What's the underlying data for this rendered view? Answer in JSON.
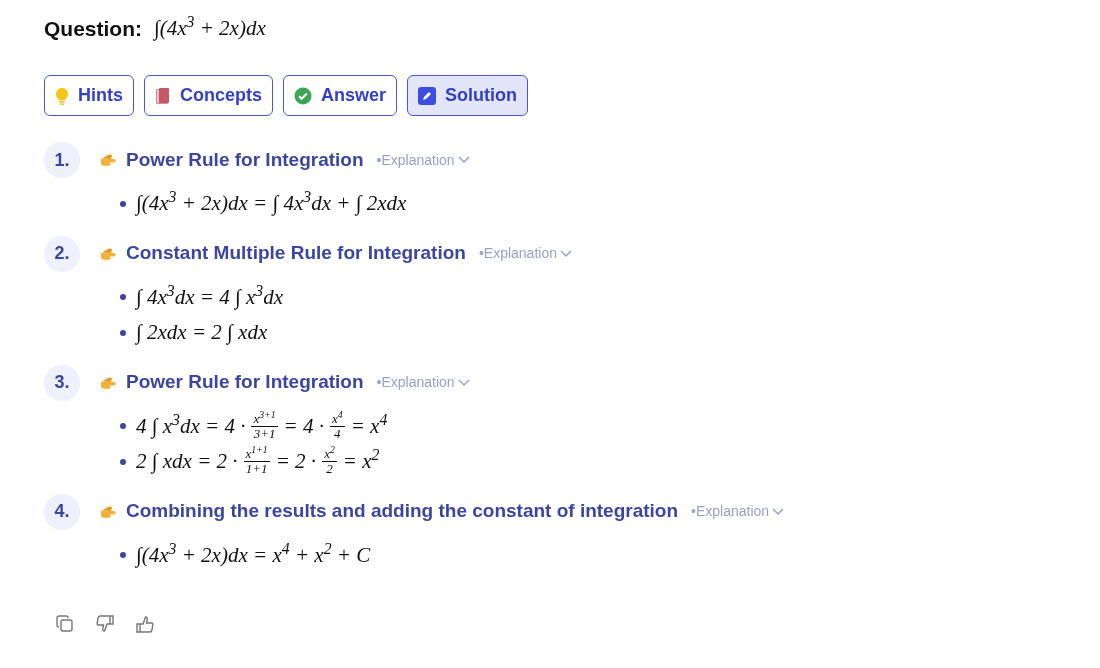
{
  "question": {
    "label": "Question:",
    "math": [
      {
        "kind": "text",
        "text": "∫(4x$^{3}$ + 2x)dx"
      }
    ]
  },
  "tabs": [
    {
      "label": "Hints",
      "selected": false
    },
    {
      "label": "Concepts",
      "selected": false
    },
    {
      "label": "Answer",
      "selected": false
    },
    {
      "label": "Solution",
      "selected": true
    }
  ],
  "steps": [
    {
      "number": "1.",
      "title": "Power Rule for Integration",
      "explanation": "•Explanation",
      "lines": [
        [
          {
            "kind": "text",
            "text": "∫(4x$^{3}$ + 2x)dx = ∫ 4x$^{3}$dx + ∫ 2xdx"
          }
        ]
      ]
    },
    {
      "number": "2.",
      "title": "Constant Multiple Rule for Integration",
      "explanation": "•Explanation",
      "lines": [
        [
          {
            "kind": "text",
            "text": "∫ 4x$^{3}$dx = 4 ∫ x$^{3}$dx"
          }
        ],
        [
          {
            "kind": "text",
            "text": "∫ 2xdx = 2 ∫ xdx"
          }
        ]
      ]
    },
    {
      "number": "3.",
      "title": "Power Rule for Integration",
      "explanation": "•Explanation",
      "lines": [
        [
          {
            "kind": "text",
            "text": "4 ∫ x$^{3}$dx = 4 ·"
          },
          {
            "kind": "frac",
            "num": "x$^{3+1}$",
            "den": "3+1"
          },
          {
            "kind": "text",
            "text": "= 4 ·"
          },
          {
            "kind": "frac",
            "num": "x$^{4}$",
            "den": "4"
          },
          {
            "kind": "text",
            "text": "= x$^{4}$"
          }
        ],
        [
          {
            "kind": "text",
            "text": "2 ∫ xdx = 2 ·"
          },
          {
            "kind": "frac",
            "num": "x$^{1+1}$",
            "den": "1+1"
          },
          {
            "kind": "text",
            "text": "= 2 ·"
          },
          {
            "kind": "frac",
            "num": "x$^{2}$",
            "den": "2"
          },
          {
            "kind": "text",
            "text": "= x$^{2}$"
          }
        ]
      ]
    },
    {
      "number": "4.",
      "title": "Combining the results and adding the constant of integration",
      "explanation": "•Explanation",
      "lines": [
        [
          {
            "kind": "text",
            "text": "∫(4x$^{3}$ + 2x)dx = x$^{4}$ + x$^{2}$ + C"
          }
        ]
      ]
    }
  ]
}
